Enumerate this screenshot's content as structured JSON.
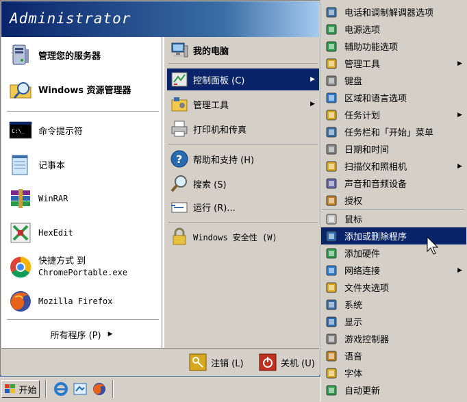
{
  "header": {
    "title": "Administrator"
  },
  "left_pinned": [
    {
      "label": "管理您的服务器",
      "icon": "server-icon"
    },
    {
      "label": "Windows 资源管理器",
      "icon": "explorer-icon"
    }
  ],
  "left_recent": [
    {
      "label": "命令提示符",
      "icon": "command-prompt-icon"
    },
    {
      "label": "记事本",
      "icon": "notepad-icon"
    },
    {
      "label": "WinRAR",
      "icon": "winrar-icon"
    },
    {
      "label": "HexEdit",
      "icon": "hexedit-icon"
    },
    {
      "label": "快捷方式 到",
      "label2": "ChromePortable.exe",
      "icon": "chrome-icon"
    },
    {
      "label": "Mozilla Firefox",
      "icon": "firefox-icon"
    }
  ],
  "all_programs": {
    "label": "所有程序 (P)",
    "arrow": "▶"
  },
  "right_items": [
    {
      "label": "我的电脑",
      "icon": "my-computer-icon"
    },
    {
      "label": "控制面板 (C)",
      "icon": "control-panel-icon",
      "arrow": "▶"
    },
    {
      "label": "管理工具",
      "icon": "admin-tools-icon",
      "arrow": "▶"
    },
    {
      "label": "打印机和传真",
      "icon": "printer-icon"
    },
    {
      "label": "帮助和支持 (H)",
      "icon": "help-icon"
    },
    {
      "label": "搜索 (S)",
      "icon": "search-icon"
    },
    {
      "label": "运行 (R)...",
      "icon": "run-icon"
    },
    {
      "label": "Windows 安全性 (W)",
      "icon": "security-icon"
    }
  ],
  "footer": {
    "logoff_label": "注销 (L)",
    "shutdown_label": "关机 (U)"
  },
  "taskbar": {
    "start_label": "开始"
  },
  "control_panel_menu": [
    {
      "label": "电话和调制解调器选项",
      "icon": "phone-modem-icon"
    },
    {
      "label": "电源选项",
      "icon": "power-icon"
    },
    {
      "label": "辅助功能选项",
      "icon": "accessibility-icon"
    },
    {
      "label": "管理工具",
      "icon": "admin-tools-icon",
      "arrow": "▶"
    },
    {
      "label": "键盘",
      "icon": "keyboard-icon"
    },
    {
      "label": "区域和语言选项",
      "icon": "globe-icon"
    },
    {
      "label": "任务计划",
      "icon": "scheduled-tasks-icon",
      "arrow": "▶"
    },
    {
      "label": "任务栏和「开始」菜单",
      "icon": "taskbar-icon"
    },
    {
      "label": "日期和时间",
      "icon": "clock-icon"
    },
    {
      "label": "扫描仪和照相机",
      "icon": "scanner-icon",
      "arrow": "▶"
    },
    {
      "label": "声音和音频设备",
      "icon": "sound-icon"
    },
    {
      "label": "授权",
      "icon": "license-icon"
    },
    {
      "label": "鼠标",
      "icon": "mouse-icon"
    },
    {
      "label": "添加或删除程序",
      "icon": "add-remove-programs-icon"
    },
    {
      "label": "添加硬件",
      "icon": "add-hardware-icon"
    },
    {
      "label": "网络连接",
      "icon": "network-icon",
      "arrow": "▶"
    },
    {
      "label": "文件夹选项",
      "icon": "folder-options-icon"
    },
    {
      "label": "系统",
      "icon": "system-icon"
    },
    {
      "label": "显示",
      "icon": "display-icon"
    },
    {
      "label": "游戏控制器",
      "icon": "game-controller-icon"
    },
    {
      "label": "语音",
      "icon": "speech-icon"
    },
    {
      "label": "字体",
      "icon": "fonts-icon"
    },
    {
      "label": "自动更新",
      "icon": "automatic-updates-icon"
    }
  ],
  "colors": {
    "highlight": "#0a246a",
    "menu_bg": "#d4d0c8",
    "header_start": "#0a246a"
  }
}
